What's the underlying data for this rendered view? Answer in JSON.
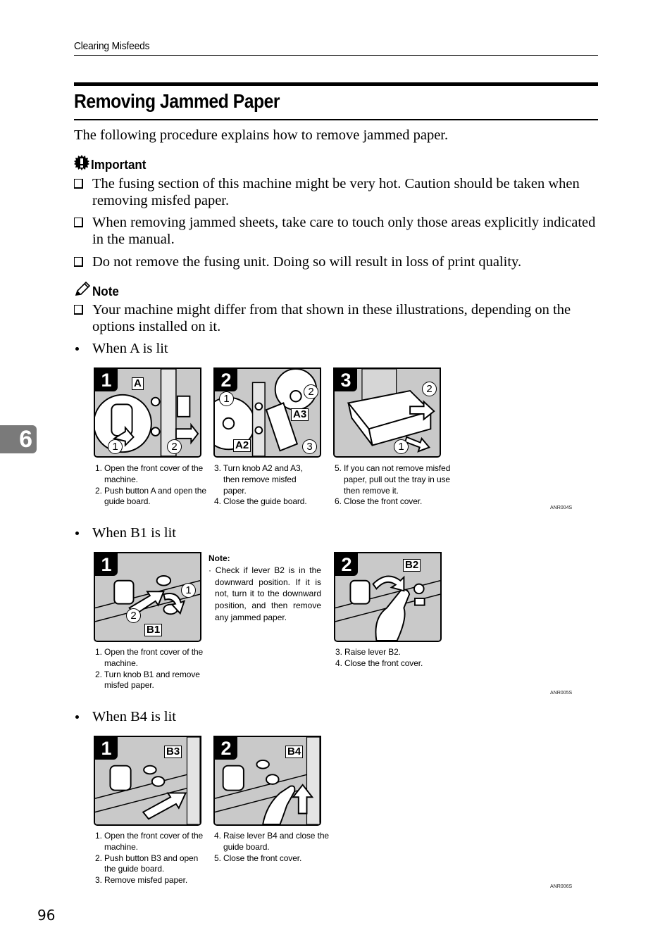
{
  "header": {
    "running_head": "Clearing Misfeeds",
    "title": "Removing Jammed Paper",
    "intro": "The following procedure explains how to remove jammed paper."
  },
  "important": {
    "icon": "important-gear-exclamation-icon",
    "label": "Important",
    "items": [
      "The fusing section of this machine might be very hot. Caution should be taken when removing misfed paper.",
      "When removing jammed sheets, take care to touch only those areas explicitly indicated in the manual.",
      "Do not remove the fusing unit. Doing so will result in loss of print quality."
    ]
  },
  "note": {
    "icon": "pencil-note-icon",
    "label": "Note",
    "items": [
      "Your machine might differ from that shown in these illustrations, depending on the options installed on it."
    ]
  },
  "chapter_tab": "6",
  "sections": [
    {
      "heading": "When A is lit",
      "figures": [
        {
          "step": "1",
          "tags": [
            "A"
          ],
          "circles": [
            "1",
            "2"
          ]
        },
        {
          "step": "2",
          "tags": [
            "A3",
            "A2"
          ],
          "circles": [
            "1",
            "2",
            "3"
          ]
        },
        {
          "step": "3",
          "tags": [],
          "circles": [
            "2",
            "1"
          ]
        }
      ],
      "step_columns": [
        [
          "1. Open the front cover of the machine.",
          "2. Push button A and open the guide board."
        ],
        [
          "3. Turn knob A2 and A3, then remove misfed paper.",
          "4. Close the guide board."
        ],
        [
          "5. If you can not remove misfed paper, pull out the tray in use then remove it.",
          "6. Close the front cover."
        ]
      ],
      "code": "ANR004S"
    },
    {
      "heading": "When B1 is lit",
      "figures": [
        {
          "step": "1",
          "tags": [
            "B1"
          ],
          "circles": [
            "1",
            "2"
          ]
        },
        {
          "step": "2",
          "tags": [
            "B2"
          ],
          "circles": []
        }
      ],
      "note_title": "Note:",
      "note_body": "Check if lever B2 is in the downward position.  If it is not, turn it to the downward position, and then remove any jammed paper.",
      "step_columns": [
        [
          "1. Open the front cover of the machine.",
          "2. Turn knob B1 and remove misfed paper."
        ],
        [
          "3. Raise lever B2.",
          "4. Close the front cover."
        ]
      ],
      "code": "ANR005S"
    },
    {
      "heading": "When B4 is lit",
      "figures": [
        {
          "step": "1",
          "tags": [
            "B3"
          ],
          "circles": []
        },
        {
          "step": "2",
          "tags": [
            "B4"
          ],
          "circles": []
        }
      ],
      "step_columns": [
        [
          "1. Open the front cover of the machine.",
          "2. Push button B3 and open the guide board.",
          "3. Remove misfed paper."
        ],
        [
          "4. Raise lever B4 and close the guide board.",
          "5. Close the front cover."
        ]
      ],
      "code": "ANR006S"
    }
  ],
  "footer": {
    "page_number": "96"
  }
}
